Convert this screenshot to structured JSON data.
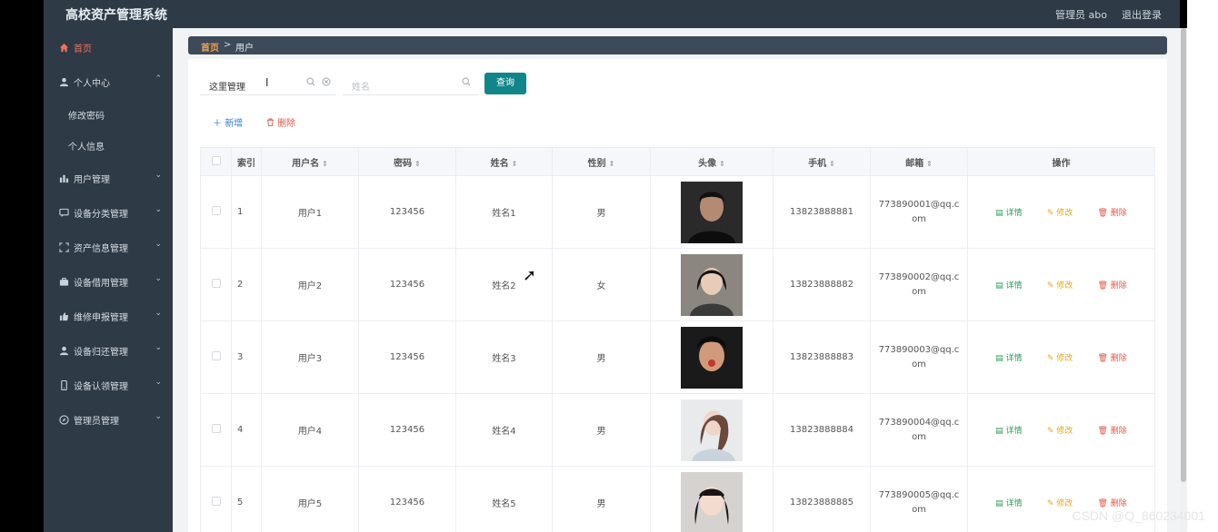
{
  "header": {
    "title": "高校资产管理系统",
    "user": "管理员 abo",
    "logout": "退出登录"
  },
  "sidebar": {
    "items": [
      {
        "label": "首页",
        "icon": "home-icon",
        "active": true
      },
      {
        "label": "个人中心",
        "icon": "user-icon",
        "expanded": true,
        "children": [
          "修改密码",
          "个人信息"
        ]
      },
      {
        "label": "用户管理",
        "icon": "bar-chart-icon"
      },
      {
        "label": "设备分类管理",
        "icon": "chat-icon"
      },
      {
        "label": "资产信息管理",
        "icon": "frame-icon"
      },
      {
        "label": "设备借用管理",
        "icon": "briefcase-icon"
      },
      {
        "label": "维修申报管理",
        "icon": "thumb-icon"
      },
      {
        "label": "设备归还管理",
        "icon": "user-icon"
      },
      {
        "label": "设备认领管理",
        "icon": "mobile-icon"
      },
      {
        "label": "管理员管理",
        "icon": "compass-icon"
      }
    ]
  },
  "breadcrumb": {
    "home": "首页",
    "sep": ">",
    "current": "用户"
  },
  "search": {
    "username_value": "这里管理",
    "name_placeholder": "姓名",
    "query_label": "查询"
  },
  "actions": {
    "add": "新增",
    "delete": "删除"
  },
  "table": {
    "columns": [
      "索引",
      "用户名",
      "密码",
      "姓名",
      "性别",
      "头像",
      "手机",
      "邮箱",
      "操作"
    ],
    "rows": [
      {
        "index": "1",
        "username": "用户1",
        "password": "123456",
        "name": "姓名1",
        "gender": "男",
        "phone": "13823888881",
        "email": "773890001@qq.com"
      },
      {
        "index": "2",
        "username": "用户2",
        "password": "123456",
        "name": "姓名2",
        "gender": "女",
        "phone": "13823888882",
        "email": "773890002@qq.com"
      },
      {
        "index": "3",
        "username": "用户3",
        "password": "123456",
        "name": "姓名3",
        "gender": "男",
        "phone": "13823888883",
        "email": "773890003@qq.com"
      },
      {
        "index": "4",
        "username": "用户4",
        "password": "123456",
        "name": "姓名4",
        "gender": "男",
        "phone": "13823888884",
        "email": "773890004@qq.com"
      },
      {
        "index": "5",
        "username": "用户5",
        "password": "123456",
        "name": "姓名5",
        "gender": "男",
        "phone": "13823888885",
        "email": "773890005@qq.com"
      }
    ],
    "row_actions": {
      "detail": "详情",
      "edit": "修改",
      "remove": "删除"
    }
  },
  "watermark": "CSDN @Q_860234001",
  "colors": {
    "sidebar": "#2e3a46",
    "accent_active": "#f3705a",
    "query_button": "#10868a",
    "detail": "#2d9a5a",
    "edit": "#e6a817",
    "delete": "#e0594a"
  }
}
